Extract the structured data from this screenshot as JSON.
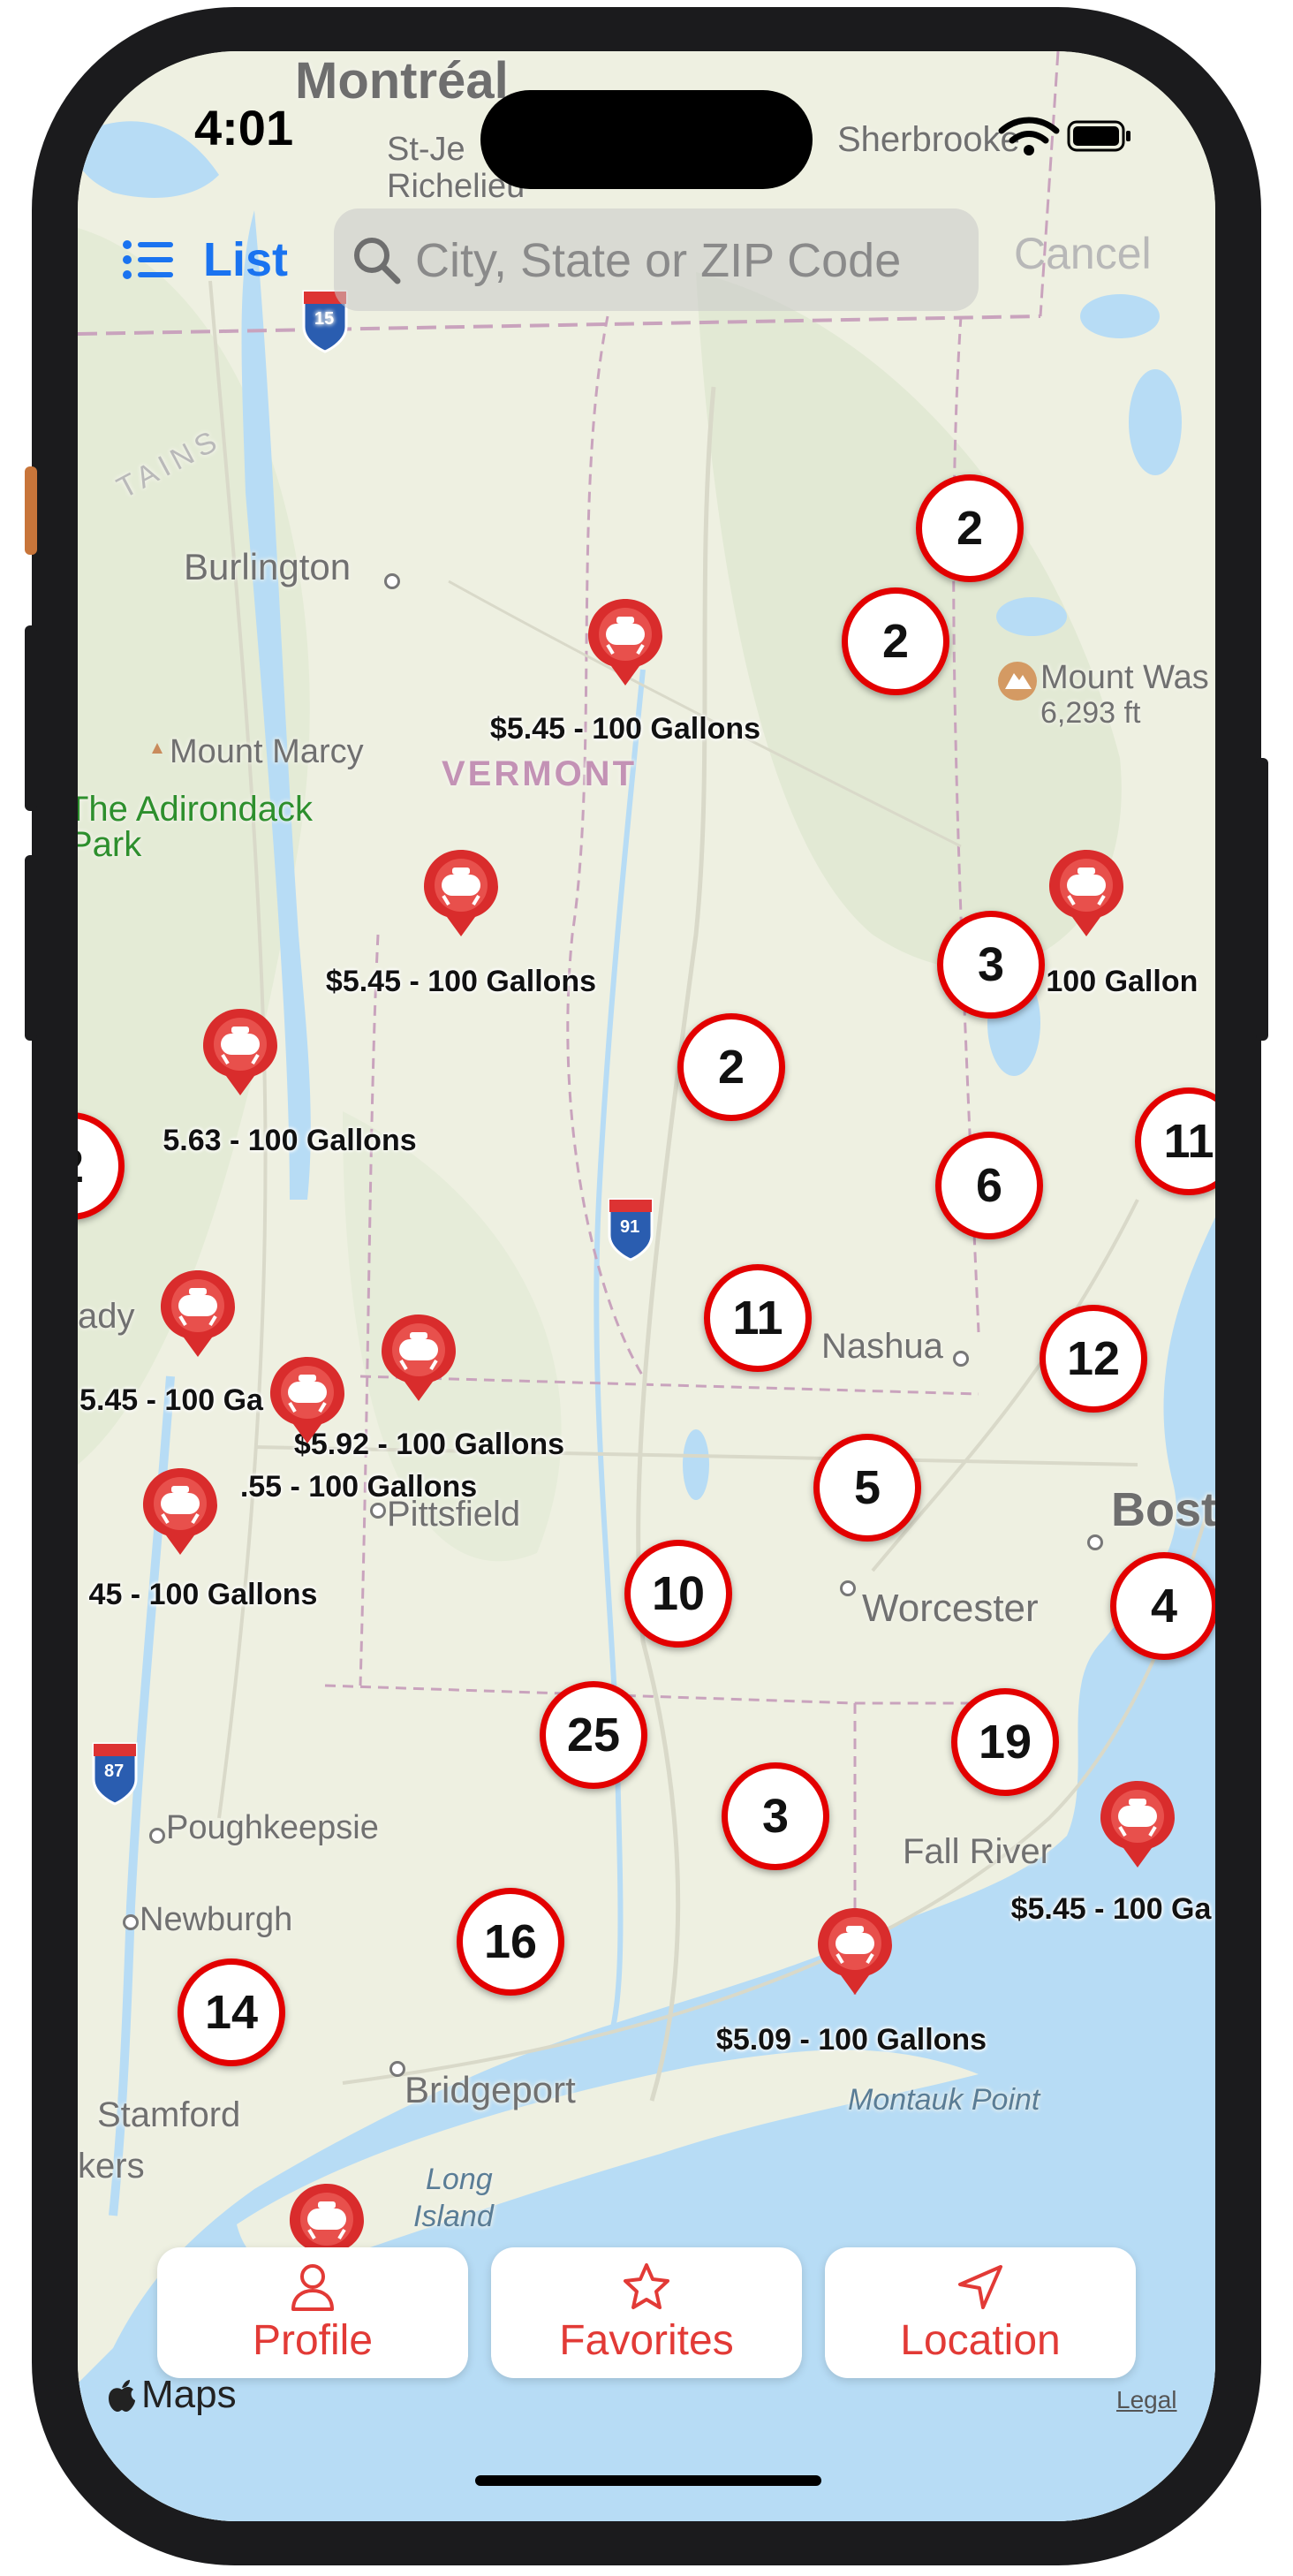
{
  "status_bar": {
    "time": "4:01"
  },
  "header": {
    "list_label": "List",
    "search_placeholder": "City, State or ZIP Code",
    "cancel_label": "Cancel"
  },
  "places": [
    {
      "label": "Montréal"
    },
    {
      "label": "St-Je"
    },
    {
      "label": "Richelieu"
    },
    {
      "label": "Sherbrooke"
    },
    {
      "label": "Burlington"
    },
    {
      "label": "Mount Marcy"
    },
    {
      "label": "VERMONT"
    },
    {
      "label": "The Adirondack"
    },
    {
      "label": "Park"
    },
    {
      "label": "Mount Was"
    },
    {
      "label": "6,293 ft"
    },
    {
      "label": "Nashua"
    },
    {
      "label": "Bost"
    },
    {
      "label": "Worcester"
    },
    {
      "label": "Pittsfield"
    },
    {
      "label": "Poughkeepsie"
    },
    {
      "label": "Newburgh"
    },
    {
      "label": "Fall River"
    },
    {
      "label": "Bridgeport"
    },
    {
      "label": "Stamford"
    },
    {
      "label": "Montauk Point"
    },
    {
      "label": "Long"
    },
    {
      "label": "Island"
    },
    {
      "label": "kers"
    },
    {
      "label": "ady"
    },
    {
      "label": "TAINS"
    },
    {
      "label": "15"
    },
    {
      "label": "91"
    },
    {
      "label": "87"
    }
  ],
  "clusters": [
    {
      "count": "2"
    },
    {
      "count": "2"
    },
    {
      "count": "3"
    },
    {
      "count": "2"
    },
    {
      "count": "11"
    },
    {
      "count": "6"
    },
    {
      "count": "2"
    },
    {
      "count": "11"
    },
    {
      "count": "12"
    },
    {
      "count": "5"
    },
    {
      "count": "10"
    },
    {
      "count": "4"
    },
    {
      "count": "25"
    },
    {
      "count": "19"
    },
    {
      "count": "3"
    },
    {
      "count": "16"
    },
    {
      "count": "14"
    }
  ],
  "price_pins": [
    {
      "label": "$5.45 - 100 Gallons"
    },
    {
      "label": "$5.45 - 100 Gallons"
    },
    {
      "label": "- 100 Gallon"
    },
    {
      "label": "5.63 - 100 Gallons"
    },
    {
      "label": "5.45 - 100 Ga"
    },
    {
      "label": "$5.92 - 100 Gallons"
    },
    {
      "label": ".55 - 100 Gallons"
    },
    {
      "label": "45 - 100 Gallons"
    },
    {
      "label": "$5.45 - 100 Ga"
    },
    {
      "label": "$5.09 - 100 Gallons"
    },
    {
      "label": "$"
    }
  ],
  "tabs": [
    {
      "label": "Profile",
      "icon": "person-icon"
    },
    {
      "label": "Favorites",
      "icon": "star-icon"
    },
    {
      "label": "Location",
      "icon": "location-arrow-icon"
    }
  ],
  "footer": {
    "maps_label": "Maps",
    "legal_label": "Legal"
  },
  "colors": {
    "accent": "#e23a36",
    "cluster_ring": "#e30000",
    "link_blue": "#1a73f0",
    "water": "#b7dcf5",
    "land": "#eef0e1"
  }
}
